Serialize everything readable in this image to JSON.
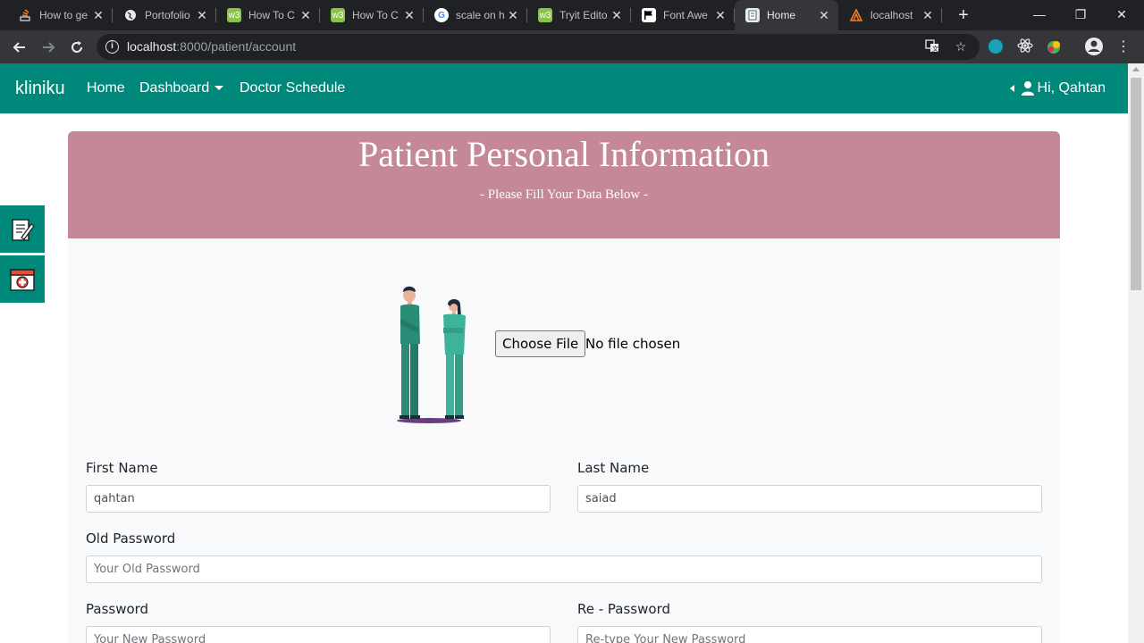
{
  "browser": {
    "tabs": [
      {
        "title": "How to ge",
        "favicon": "stack-icon",
        "color": "#f48024"
      },
      {
        "title": "Portofolio",
        "favicon": "globe-icon",
        "color": "#9aa0a6"
      },
      {
        "title": "How To C",
        "favicon": "w3-icon",
        "color": "#8bc34a"
      },
      {
        "title": "How To C",
        "favicon": "w3-icon",
        "color": "#8bc34a"
      },
      {
        "title": "scale on h",
        "favicon": "google-icon",
        "color": "#4285f4"
      },
      {
        "title": "Tryit Edito",
        "favicon": "w3-icon",
        "color": "#8bc34a"
      },
      {
        "title": "Font Awe",
        "favicon": "flag-icon",
        "color": "#000000"
      },
      {
        "title": "Home",
        "favicon": "page-icon",
        "color": "#ffffff"
      },
      {
        "title": "localhost",
        "favicon": "xampp-icon",
        "color": "#fb7a24"
      }
    ],
    "url_host": "localhost",
    "url_rest": ":8000/patient/account"
  },
  "navbar": {
    "brand": "kliniku",
    "links": [
      "Home",
      "Dashboard",
      "Doctor Schedule"
    ],
    "user": "Hi, Qahtan"
  },
  "hero": {
    "title": "Patient Personal Information",
    "subtitle": "- Please Fill Your Data Below -"
  },
  "upload": {
    "button": "Choose File",
    "status": "No file chosen"
  },
  "form": {
    "first_name_label": "First Name",
    "first_name_value": "qahtan",
    "last_name_label": "Last Name",
    "last_name_value": "saiad",
    "old_password_label": "Old Password",
    "old_password_placeholder": "Your Old Password",
    "password_label": "Password",
    "password_placeholder": "Your New Password",
    "repassword_label": "Re - Password",
    "repassword_placeholder": "Re-type Your New Password"
  },
  "colors": {
    "navbar": "#00897b",
    "hero": "#c48898",
    "card": "#f8f9fa"
  }
}
